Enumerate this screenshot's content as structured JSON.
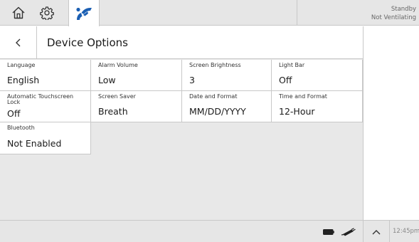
{
  "status": {
    "line1": "Standby",
    "line2": "Not Ventilating"
  },
  "page": {
    "title": "Device Options"
  },
  "options": [
    {
      "label": "Language",
      "value": "English"
    },
    {
      "label": "Alarm Volume",
      "value": "Low"
    },
    {
      "label": "Screen Brightness",
      "value": "3"
    },
    {
      "label": "Light Bar",
      "value": "Off"
    },
    {
      "label": "Automatic Touchscreen Lock",
      "value": "Off"
    },
    {
      "label": "Screen Saver",
      "value": "Breath"
    },
    {
      "label": "Date and Format",
      "value": "MM/DD/YYYY"
    },
    {
      "label": "Time and Format",
      "value": "12-Hour"
    },
    {
      "label": "Bluetooth",
      "value": "Not Enabled"
    }
  ],
  "footer": {
    "time": "12:45pm"
  },
  "colors": {
    "accent": "#1b5fb3",
    "bar_bg": "#e6e6e6",
    "panel_bg": "#e8e8e8"
  },
  "icons": {
    "home": "home-icon",
    "settings": "gear-icon",
    "ventilation": "ventilation-icon",
    "back": "chevron-left-icon",
    "battery": "battery-icon",
    "ac_power": "power-plug-icon",
    "expand": "chevron-up-icon"
  }
}
